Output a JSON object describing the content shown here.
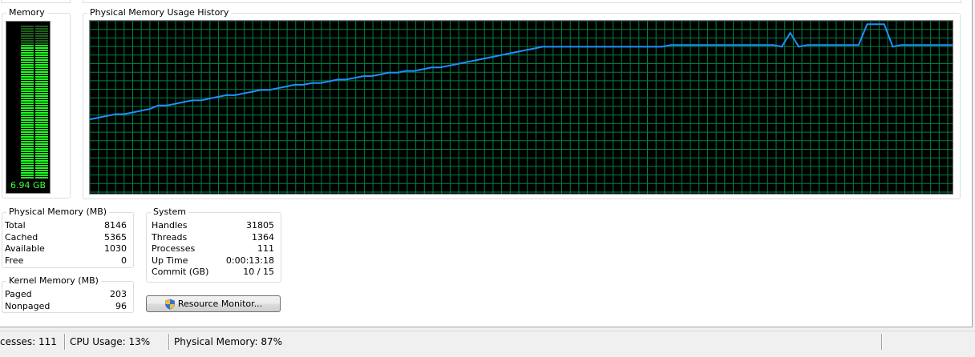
{
  "memory_meter": {
    "title": "Memory",
    "value_label": "6.94 GB",
    "used_fraction": 0.87,
    "color": "#22ff22"
  },
  "history": {
    "title": "Physical Memory Usage History",
    "grid_color": "#008040",
    "line_color": "#1e90ff",
    "max_percent": 100,
    "usage_percent": [
      43,
      44,
      45,
      46,
      46,
      47,
      48,
      49,
      51,
      51,
      52,
      53,
      54,
      54,
      55,
      56,
      57,
      57,
      58,
      59,
      60,
      60,
      61,
      62,
      63,
      63,
      64,
      64,
      65,
      66,
      66,
      67,
      68,
      68,
      69,
      70,
      70,
      71,
      71,
      72,
      73,
      73,
      74,
      75,
      76,
      77,
      78,
      79,
      80,
      81,
      82,
      83,
      84,
      85,
      85,
      85,
      85,
      85,
      85,
      85,
      85,
      85,
      85,
      85,
      85,
      85,
      85,
      85,
      86,
      86,
      86,
      86,
      86,
      86,
      86,
      86,
      86,
      86,
      86,
      86,
      86,
      85,
      93,
      85,
      86,
      86,
      86,
      86,
      86,
      86,
      86,
      98,
      98,
      98,
      85,
      86,
      86,
      86,
      86,
      86,
      86,
      86
    ]
  },
  "physical_memory": {
    "title": "Physical Memory (MB)",
    "rows": [
      {
        "label": "Total",
        "value": "8146"
      },
      {
        "label": "Cached",
        "value": "5365"
      },
      {
        "label": "Available",
        "value": "1030"
      },
      {
        "label": "Free",
        "value": "0"
      }
    ]
  },
  "kernel_memory": {
    "title": "Kernel Memory (MB)",
    "rows": [
      {
        "label": "Paged",
        "value": "203"
      },
      {
        "label": "Nonpaged",
        "value": "96"
      }
    ]
  },
  "system": {
    "title": "System",
    "rows": [
      {
        "label": "Handles",
        "value": "31805"
      },
      {
        "label": "Threads",
        "value": "1364"
      },
      {
        "label": "Processes",
        "value": "111"
      },
      {
        "label": "Up Time",
        "value": "0:00:13:18"
      },
      {
        "label": "Commit (GB)",
        "value": "10 / 15"
      }
    ]
  },
  "resource_monitor_button": {
    "label": "Resource Monitor...",
    "icon": "uac-shield-icon"
  },
  "statusbar": {
    "processes": "cesses: 111",
    "cpu": "CPU Usage: 13%",
    "memory": "Physical Memory: 87%"
  }
}
